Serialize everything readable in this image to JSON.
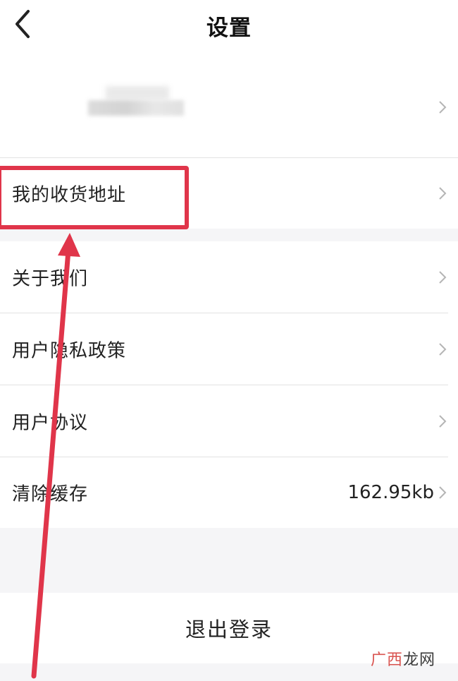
{
  "header": {
    "title": "设置",
    "back_icon": "chevron-left-icon"
  },
  "profile": {
    "name_blurred": true
  },
  "menu": [
    {
      "label": "我的收货地址",
      "value": ""
    },
    {
      "label": "关于我们",
      "value": ""
    },
    {
      "label": "用户隐私政策",
      "value": ""
    },
    {
      "label": "用户协议",
      "value": ""
    },
    {
      "label": "清除缓存",
      "value": "162.95kb"
    }
  ],
  "logout": {
    "label": "退出登录"
  },
  "annotation": {
    "color": "#e0354a",
    "arrow": "arrow-up-icon"
  },
  "watermark": {
    "part1": "广西",
    "part2": "龙网"
  },
  "colors": {
    "background": "#ffffff",
    "section_gap": "#f5f5f7",
    "chevron": "#b5b5b5",
    "annotation_red": "#e0354a"
  }
}
